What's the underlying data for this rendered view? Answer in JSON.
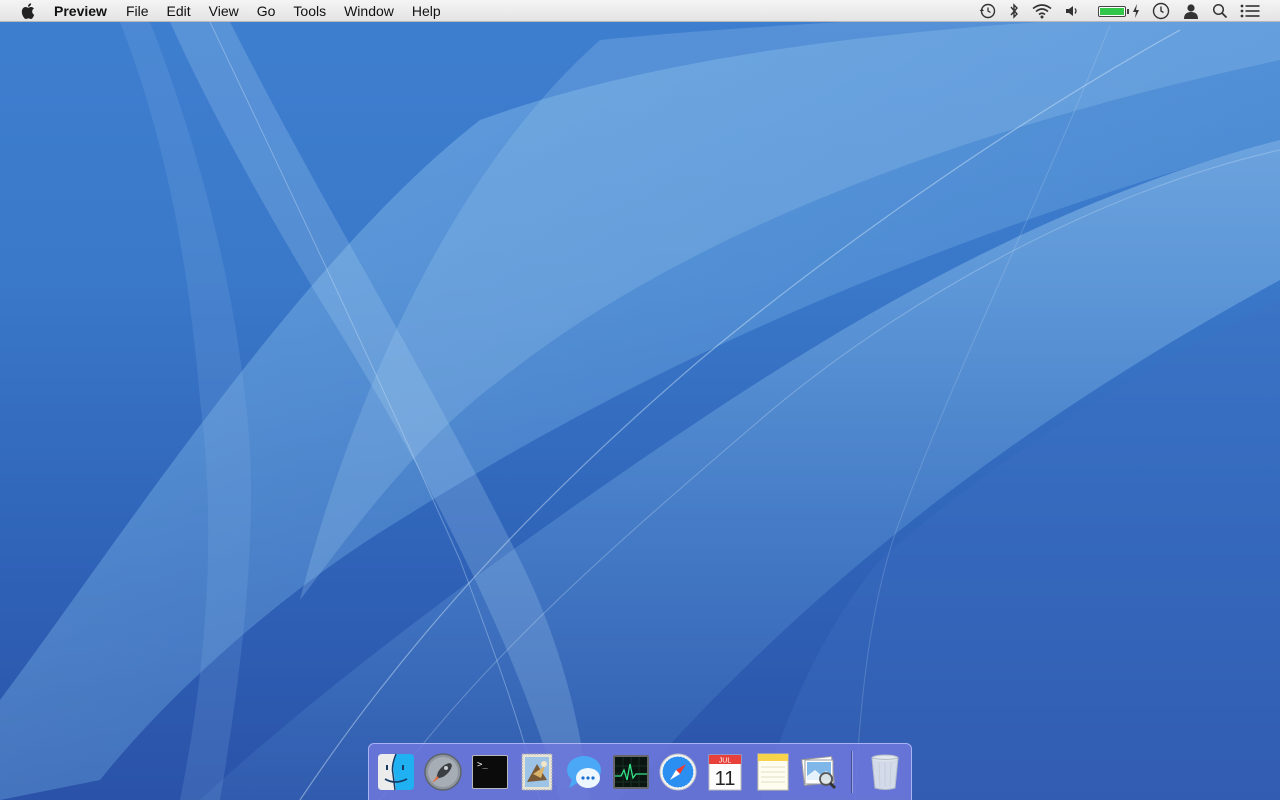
{
  "menubar": {
    "app_name": "Preview",
    "items": [
      "File",
      "Edit",
      "View",
      "Go",
      "Tools",
      "Window",
      "Help"
    ],
    "status_icons": [
      "time-machine-icon",
      "bluetooth-icon",
      "wifi-icon",
      "volume-icon",
      "battery-icon",
      "charging-icon",
      "clock-icon",
      "user-icon",
      "spotlight-icon",
      "notification-center-icon"
    ],
    "battery_level": 1.0
  },
  "calendar": {
    "month": "JUL",
    "day": "11"
  },
  "terminal": {
    "prompt": ">_"
  },
  "dock": {
    "apps": [
      "Finder",
      "Launchpad",
      "Terminal",
      "Mail",
      "Messages",
      "Activity Monitor",
      "Safari",
      "Calendar",
      "Notes",
      "Preview",
      "Trash"
    ]
  },
  "colors": {
    "battery": "#32c74b",
    "calendar_red": "#e8413b"
  }
}
